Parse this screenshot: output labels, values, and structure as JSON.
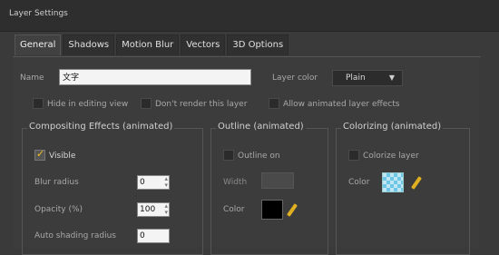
{
  "window": {
    "title": "Layer Settings"
  },
  "tabs": [
    {
      "label": "General",
      "active": true
    },
    {
      "label": "Shadows",
      "active": false
    },
    {
      "label": "Motion Blur",
      "active": false
    },
    {
      "label": "Vectors",
      "active": false
    },
    {
      "label": "3D Options",
      "active": false
    }
  ],
  "general": {
    "name_label": "Name",
    "name_value": "文字",
    "layer_color_label": "Layer color",
    "layer_color_value": "Plain",
    "options": [
      {
        "label": "Hide in editing view",
        "checked": false
      },
      {
        "label": "Don't render this layer",
        "checked": false
      },
      {
        "label": "Allow animated layer effects",
        "checked": false
      }
    ]
  },
  "compositing": {
    "title": "Compositing Effects (animated)",
    "visible_label": "Visible",
    "visible_checked": true,
    "blur_label": "Blur radius",
    "blur_value": "0",
    "opacity_label": "Opacity (%)",
    "opacity_value": "100",
    "auto_shading_label": "Auto shading radius",
    "auto_shading_value": "0"
  },
  "outline": {
    "title": "Outline (animated)",
    "outline_on_label": "Outline on",
    "outline_on_checked": false,
    "width_label": "Width",
    "color_label": "Color",
    "color_value": "#000000"
  },
  "colorizing": {
    "title": "Colorizing (animated)",
    "colorize_label": "Colorize layer",
    "colorize_checked": false,
    "color_label": "Color",
    "swatch_color": "#6ec6e6"
  },
  "colors": {
    "accent_check": "#f0c020",
    "pencil": "#e0b020"
  }
}
